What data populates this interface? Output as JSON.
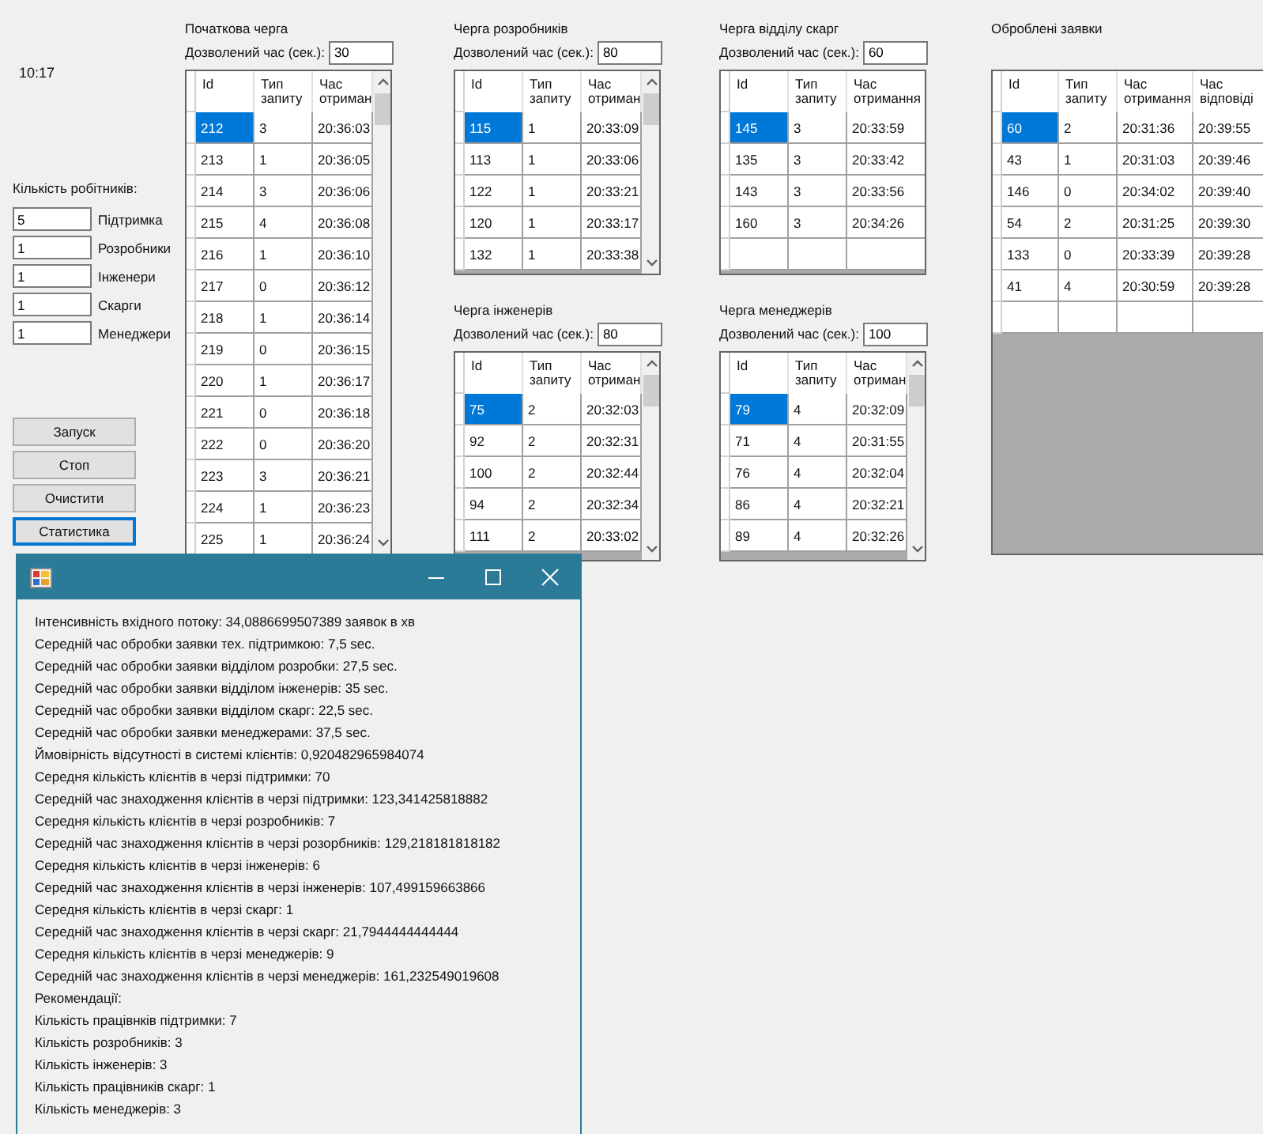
{
  "clock": "10:17",
  "workers": {
    "title": "Кількість робітників:",
    "fields": [
      {
        "value": "5",
        "label": "Підтримка"
      },
      {
        "value": "1",
        "label": "Розробники"
      },
      {
        "value": "1",
        "label": "Інженери"
      },
      {
        "value": "1",
        "label": "Скарги"
      },
      {
        "value": "1",
        "label": "Менеджери"
      }
    ]
  },
  "buttons": [
    {
      "label": "Запуск",
      "focused": false
    },
    {
      "label": "Стоп",
      "focused": false
    },
    {
      "label": "Очистити",
      "focused": false
    },
    {
      "label": "Статистика",
      "focused": true
    }
  ],
  "queues": [
    {
      "title": "Початкова черга",
      "limit_label": "Дозволений час (сек.):",
      "limit": "30",
      "columns": [
        "Id",
        "Тип запиту",
        "Час отриман"
      ],
      "scrollbar": true,
      "new_row": false,
      "rows": [
        {
          "cells": [
            "212",
            "3",
            "20:36:03"
          ],
          "selected": true
        },
        {
          "cells": [
            "213",
            "1",
            "20:36:05"
          ],
          "selected": false
        },
        {
          "cells": [
            "214",
            "3",
            "20:36:06"
          ],
          "selected": false
        },
        {
          "cells": [
            "215",
            "4",
            "20:36:08"
          ],
          "selected": false
        },
        {
          "cells": [
            "216",
            "1",
            "20:36:10"
          ],
          "selected": false
        },
        {
          "cells": [
            "217",
            "0",
            "20:36:12"
          ],
          "selected": false
        },
        {
          "cells": [
            "218",
            "1",
            "20:36:14"
          ],
          "selected": false
        },
        {
          "cells": [
            "219",
            "0",
            "20:36:15"
          ],
          "selected": false
        },
        {
          "cells": [
            "220",
            "1",
            "20:36:17"
          ],
          "selected": false
        },
        {
          "cells": [
            "221",
            "0",
            "20:36:18"
          ],
          "selected": false
        },
        {
          "cells": [
            "222",
            "0",
            "20:36:20"
          ],
          "selected": false
        },
        {
          "cells": [
            "223",
            "3",
            "20:36:21"
          ],
          "selected": false
        },
        {
          "cells": [
            "224",
            "1",
            "20:36:23"
          ],
          "selected": false
        },
        {
          "cells": [
            "225",
            "1",
            "20:36:24"
          ],
          "selected": false
        }
      ]
    },
    {
      "title": "Черга розробників",
      "limit_label": "Дозволений час (сек.):",
      "limit": "80",
      "columns": [
        "Id",
        "Тип запиту",
        "Час отриман"
      ],
      "scrollbar": true,
      "new_row": false,
      "rows": [
        {
          "cells": [
            "115",
            "1",
            "20:33:09"
          ],
          "selected": true
        },
        {
          "cells": [
            "113",
            "1",
            "20:33:06"
          ],
          "selected": false
        },
        {
          "cells": [
            "122",
            "1",
            "20:33:21"
          ],
          "selected": false
        },
        {
          "cells": [
            "120",
            "1",
            "20:33:17"
          ],
          "selected": false
        },
        {
          "cells": [
            "132",
            "1",
            "20:33:38"
          ],
          "selected": false
        }
      ]
    },
    {
      "title": "Черга відділу скарг",
      "limit_label": "Дозволений час (сек.):",
      "limit": "60",
      "columns": [
        "Id",
        "Тип запиту",
        "Час отримання"
      ],
      "scrollbar": false,
      "new_row": true,
      "rows": [
        {
          "cells": [
            "145",
            "3",
            "20:33:59"
          ],
          "selected": true
        },
        {
          "cells": [
            "135",
            "3",
            "20:33:42"
          ],
          "selected": false
        },
        {
          "cells": [
            "143",
            "3",
            "20:33:56"
          ],
          "selected": false
        },
        {
          "cells": [
            "160",
            "3",
            "20:34:26"
          ],
          "selected": false
        }
      ]
    },
    {
      "title": "Черга інженерів",
      "limit_label": "Дозволений час (сек.):",
      "limit": "80",
      "columns": [
        "Id",
        "Тип запиту",
        "Час отриман"
      ],
      "scrollbar": true,
      "new_row": false,
      "rows": [
        {
          "cells": [
            "75",
            "2",
            "20:32:03"
          ],
          "selected": true
        },
        {
          "cells": [
            "92",
            "2",
            "20:32:31"
          ],
          "selected": false
        },
        {
          "cells": [
            "100",
            "2",
            "20:32:44"
          ],
          "selected": false
        },
        {
          "cells": [
            "94",
            "2",
            "20:32:34"
          ],
          "selected": false
        },
        {
          "cells": [
            "111",
            "2",
            "20:33:02"
          ],
          "selected": false
        }
      ]
    },
    {
      "title": "Черга менеджерів",
      "limit_label": "Дозволений час (сек.):",
      "limit": "100",
      "columns": [
        "Id",
        "Тип запиту",
        "Час отриман"
      ],
      "scrollbar": true,
      "new_row": false,
      "rows": [
        {
          "cells": [
            "79",
            "4",
            "20:32:09"
          ],
          "selected": true
        },
        {
          "cells": [
            "71",
            "4",
            "20:31:55"
          ],
          "selected": false
        },
        {
          "cells": [
            "76",
            "4",
            "20:32:04"
          ],
          "selected": false
        },
        {
          "cells": [
            "86",
            "4",
            "20:32:21"
          ],
          "selected": false
        },
        {
          "cells": [
            "89",
            "4",
            "20:32:26"
          ],
          "selected": false
        }
      ]
    }
  ],
  "processed": {
    "title": "Оброблені заявки",
    "columns": [
      "Id",
      "Тип запиту",
      "Час отримання",
      "Час відповіді"
    ],
    "scrollbar": false,
    "new_row": true,
    "rows": [
      {
        "cells": [
          "60",
          "2",
          "20:31:36",
          "20:39:55"
        ],
        "selected": true
      },
      {
        "cells": [
          "43",
          "1",
          "20:31:03",
          "20:39:46"
        ],
        "selected": false
      },
      {
        "cells": [
          "146",
          "0",
          "20:34:02",
          "20:39:40"
        ],
        "selected": false
      },
      {
        "cells": [
          "54",
          "2",
          "20:31:25",
          "20:39:30"
        ],
        "selected": false
      },
      {
        "cells": [
          "133",
          "0",
          "20:33:39",
          "20:39:28"
        ],
        "selected": false
      },
      {
        "cells": [
          "41",
          "4",
          "20:30:59",
          "20:39:28"
        ],
        "selected": false
      }
    ]
  },
  "stats_window": {
    "lines": [
      "Інтенсивність вхідного потоку: 34,0886699507389 заявок в хв",
      "Середній час обробки заявки тех. підтримкою: 7,5 sec.",
      "Середній час обробки заявки відділом розробки: 27,5 sec.",
      "Середній час обробки заявки відділом інженерів: 35 sec.",
      "Середній час обробки заявки відділом скарг: 22,5 sec.",
      "Середній час обробки заявки менеджерами: 37,5 sec.",
      "Ймовірність відсутності в системі клієнтів: 0,920482965984074",
      "Середня кількість клієнтів в черзі підтримки: 70",
      "Середній час знаходження клієнтів в черзі підтримки: 123,341425818882",
      "Середня кількість клієнтів в черзі розробників: 7",
      "Середній час знаходження клієнтів в черзі розорбників: 129,218181818182",
      "Середня кількість клієнтів в черзі інженерів: 6",
      "Середній час знаходження клієнтів в черзі інженерів: 107,499159663866",
      "Середня кількість клієнтів в черзі скарг: 1",
      "Середній час знаходження клієнтів в черзі скарг: 21,7944444444444",
      "Середня кількість клієнтів в черзі менеджерів: 9",
      "Середній час знаходження клієнтів в черзі менеджерів: 161,232549019608",
      "Рекомендації:",
      "Кількість працівнків підтримки: 7",
      "Кількість розробників: 3",
      "Кількість інженерів: 3",
      "Кількість працівників скарг: 1",
      "Кількість менеджерів: 3"
    ]
  }
}
